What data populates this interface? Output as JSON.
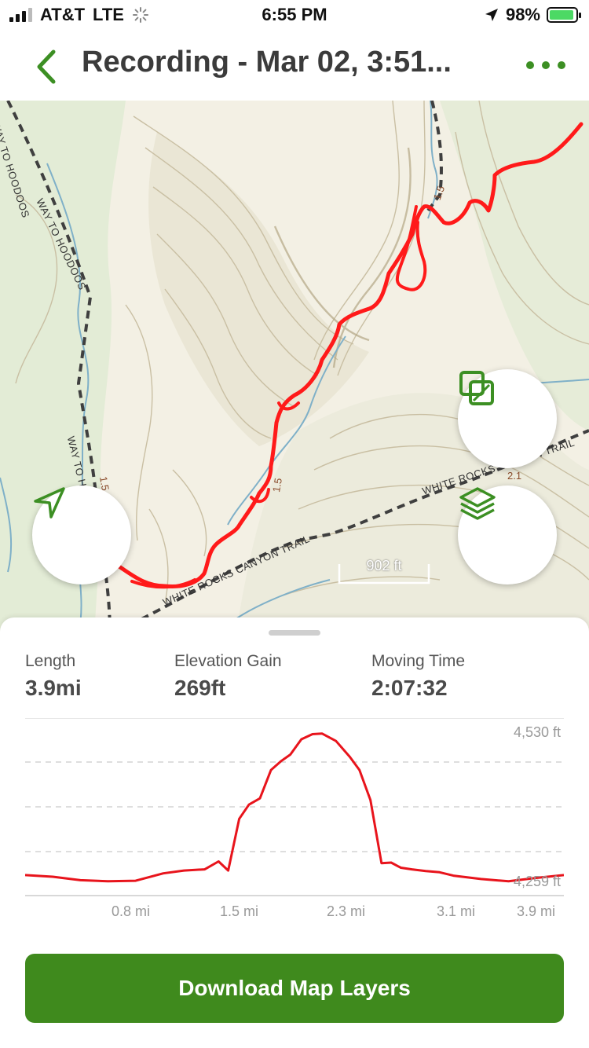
{
  "status_bar": {
    "carrier": "AT&T",
    "network": "LTE",
    "time": "6:55 PM",
    "battery": "98%"
  },
  "header": {
    "title": "Recording - Mar 02, 3:51..."
  },
  "map": {
    "trail_labels": [
      "WAY TO HOODOOS",
      "WAY TO HOODOOS",
      "WAY TO H",
      "WHITE ROCKS CANYON TRAIL",
      "WHITE ROCKS CANYON TRAIL"
    ],
    "mile_markers": [
      "1.5",
      "1.5",
      "1.5",
      "2.1"
    ],
    "scale": "902 ft",
    "route_color": "#ff1a1a",
    "accent_color": "#3c8f23"
  },
  "stats": {
    "length": {
      "label": "Length",
      "value": "3.9mi"
    },
    "elevation_gain": {
      "label": "Elevation Gain",
      "value": "269ft"
    },
    "moving_time": {
      "label": "Moving Time",
      "value": "2:07:32"
    }
  },
  "chart_data": {
    "type": "line",
    "x_ticks": [
      "0.8 mi",
      "1.5 mi",
      "2.3 mi",
      "3.1 mi",
      "3.9 mi"
    ],
    "y_labels": [
      "4,530 ft",
      "4,259 ft"
    ],
    "ylim": [
      4259,
      4530
    ],
    "xlim": [
      0,
      3.9
    ],
    "x": [
      0.0,
      0.2,
      0.4,
      0.6,
      0.8,
      1.0,
      1.15,
      1.3,
      1.4,
      1.47,
      1.55,
      1.62,
      1.7,
      1.78,
      1.85,
      1.92,
      2.0,
      2.08,
      2.15,
      2.25,
      2.35,
      2.42,
      2.5,
      2.58,
      2.65,
      2.72,
      2.8,
      2.9,
      3.0,
      3.1,
      3.3,
      3.5,
      3.7,
      3.9
    ],
    "y": [
      4273,
      4270,
      4264,
      4262,
      4263,
      4276,
      4281,
      4283,
      4297,
      4281,
      4372,
      4397,
      4408,
      4458,
      4473,
      4485,
      4512,
      4521,
      4522,
      4509,
      4481,
      4458,
      4405,
      4294,
      4295,
      4286,
      4283,
      4280,
      4278,
      4272,
      4266,
      4262,
      4268,
      4273
    ],
    "grid": true
  },
  "download_button": {
    "label": "Download Map Layers"
  }
}
